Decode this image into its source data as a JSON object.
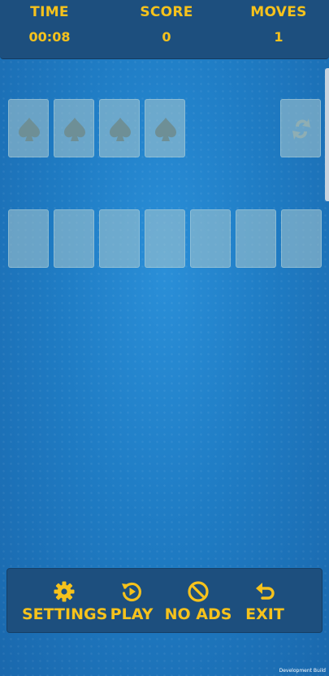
{
  "header": {
    "time_label": "TIME",
    "time_value": "00:08",
    "score_label": "SCORE",
    "score_value": "0",
    "moves_label": "MOVES",
    "moves_value": "1"
  },
  "foundations": [
    {
      "suit": "spade"
    },
    {
      "suit": "spade"
    },
    {
      "suit": "spade"
    },
    {
      "suit": "spade"
    }
  ],
  "stock": {
    "icon": "refresh-icon"
  },
  "tableau_columns": 7,
  "menu": {
    "settings_label": "SETTINGS",
    "play_label": "PLAY",
    "no_ads_label": "NO ADS",
    "exit_label": "EXIT"
  },
  "footer": {
    "build_label": "Development Build"
  },
  "colors": {
    "accent": "#f6c21c",
    "bar": "#1d4f7e",
    "table": "#1f7cc4"
  }
}
